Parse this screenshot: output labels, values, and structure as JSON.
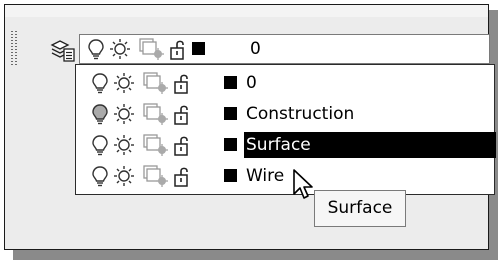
{
  "combo": {
    "selected_layer": "0"
  },
  "layers": [
    {
      "name": "0"
    },
    {
      "name": "Construction"
    },
    {
      "name": "Surface",
      "selected": true
    },
    {
      "name": "Wire"
    }
  ],
  "tooltip": {
    "text": "Surface"
  },
  "icons": {
    "layer_manager": "layer-properties-manager-icon",
    "on_off": "lightbulb-icon",
    "freeze": "sun-icon",
    "viewport_freeze": "viewport-freeze-icon",
    "lock": "unlocked-padlock-icon",
    "color": "color-swatch-icon"
  },
  "colors": {
    "swatch": "#000000",
    "highlight": "#000000"
  }
}
